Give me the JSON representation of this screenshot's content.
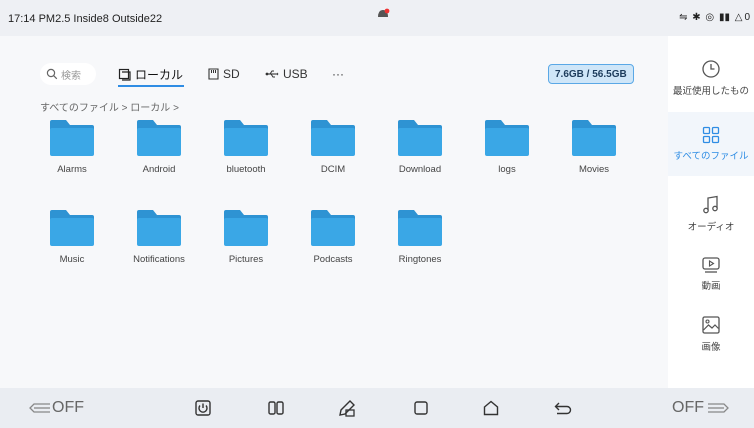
{
  "status": {
    "left_text": "17:14 PM2.5 Inside8 Outside22",
    "right_text": "0"
  },
  "toolbar": {
    "search_placeholder": "検索",
    "tabs": [
      {
        "label": "ローカル",
        "icon": "local-storage-icon"
      },
      {
        "label": "SD",
        "icon": "sd-card-icon"
      },
      {
        "label": "USB",
        "icon": "usb-icon"
      },
      {
        "label": "···",
        "icon": "more-icon"
      }
    ],
    "storage": "7.6GB / 56.5GB"
  },
  "breadcrumb": "すべてのファイル > ローカル >",
  "folders": [
    "Alarms",
    "Android",
    "bluetooth",
    "DCIM",
    "Download",
    "logs",
    "Movies",
    "Music",
    "Notifications",
    "Pictures",
    "Podcasts",
    "Ringtones"
  ],
  "sidebar": {
    "items": [
      {
        "label": "最近使用したもの",
        "icon": "clock-icon"
      },
      {
        "label": "すべてのファイル",
        "icon": "grid-icon"
      },
      {
        "label": "オーディオ",
        "icon": "music-note-icon"
      },
      {
        "label": "動画",
        "icon": "video-icon"
      },
      {
        "label": "画像",
        "icon": "image-icon"
      }
    ],
    "active_index": 1
  },
  "navbar": {
    "left_off": "OFF",
    "right_off": "OFF"
  },
  "colors": {
    "accent": "#2f8de4",
    "folder": "#3aa7e6",
    "folder_tab": "#2e93d3"
  }
}
